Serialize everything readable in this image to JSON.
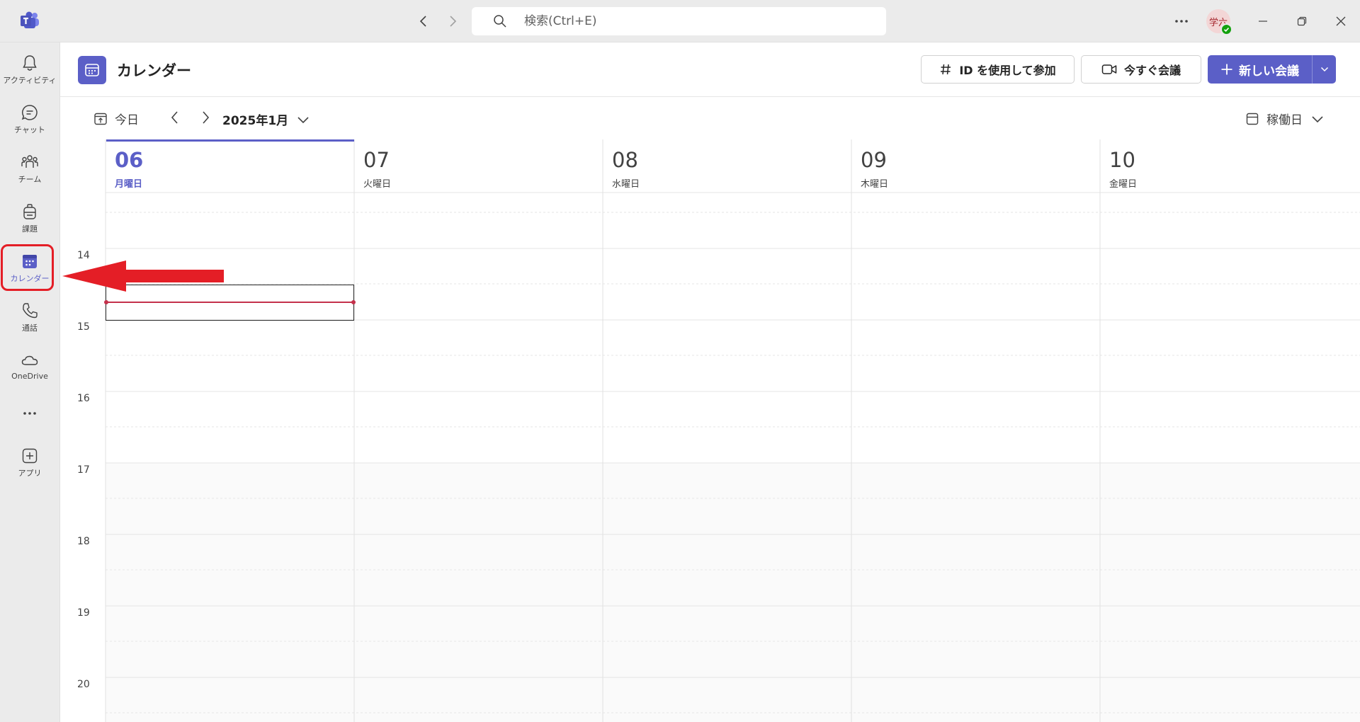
{
  "titlebar": {
    "search_placeholder": "検索(Ctrl+E)",
    "avatar_initials": "学六"
  },
  "rail": {
    "items": [
      {
        "label": "アクティビティ",
        "icon": "bell-icon"
      },
      {
        "label": "チャット",
        "icon": "chat-icon"
      },
      {
        "label": "チーム",
        "icon": "teams-icon"
      },
      {
        "label": "課題",
        "icon": "assignments-icon"
      },
      {
        "label": "カレンダー",
        "icon": "calendar-icon",
        "active": true
      },
      {
        "label": "通話",
        "icon": "phone-icon"
      },
      {
        "label": "OneDrive",
        "icon": "cloud-icon"
      },
      {
        "label": "アプリ",
        "icon": "add-apps-icon"
      }
    ]
  },
  "header": {
    "title": "カレンダー",
    "join_id_label": "ID を使用して参加",
    "meet_now_label": "今すぐ会議",
    "new_meeting_label": "新しい会議"
  },
  "toolbar": {
    "today_label": "今日",
    "month_label": "2025年1月",
    "view_label": "稼働日"
  },
  "days": [
    {
      "num": "06",
      "name": "月曜日",
      "today": true
    },
    {
      "num": "07",
      "name": "火曜日"
    },
    {
      "num": "08",
      "name": "水曜日"
    },
    {
      "num": "09",
      "name": "木曜日"
    },
    {
      "num": "10",
      "name": "金曜日"
    }
  ],
  "hours": [
    "14",
    "15",
    "16",
    "17",
    "18",
    "19",
    "20"
  ],
  "colors": {
    "accent": "#5b5fc7",
    "now_line": "#c4314b",
    "annotation_red": "#e41e26"
  }
}
